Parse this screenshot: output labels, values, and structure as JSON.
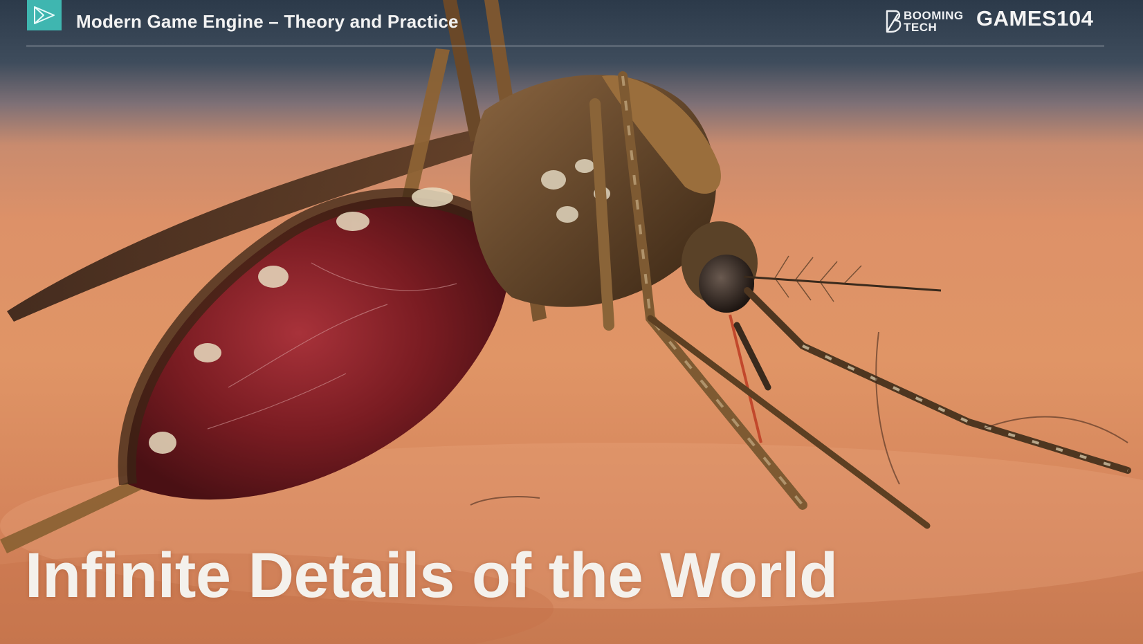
{
  "header": {
    "course_title": "Modern Game Engine – Theory and Practice",
    "brand_booming_line1": "BOOMING",
    "brand_booming_line2": "TECH",
    "brand_games": "GAMES104"
  },
  "slide": {
    "title": "Infinite Details of the World",
    "image_subject": "macro photo of a mosquito feeding on skin"
  },
  "colors": {
    "logo_accent": "#3fb6b0",
    "title_text": "#f4f1ec",
    "header_text": "#f2f2f2",
    "abdomen": "#7a1c22",
    "background_skin": "#dd9168"
  }
}
